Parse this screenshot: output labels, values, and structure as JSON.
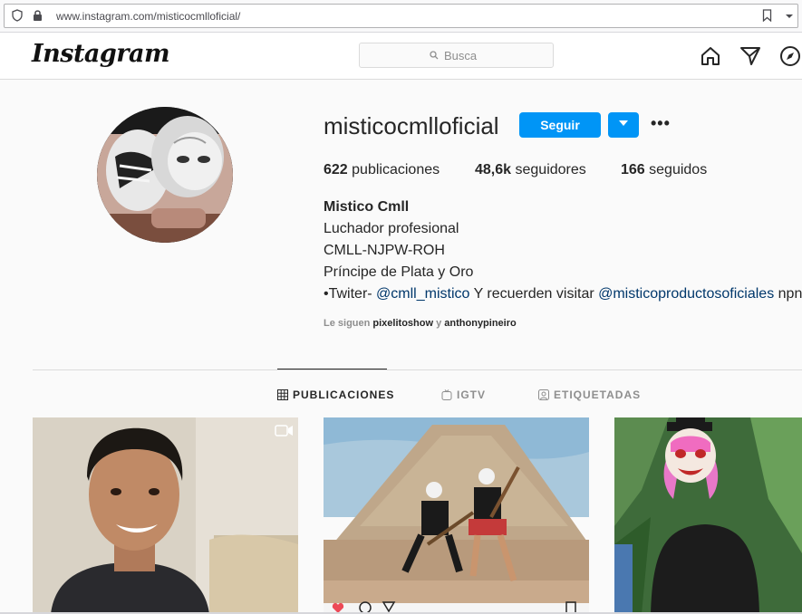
{
  "browser": {
    "url": "www.instagram.com/misticocmlloficial/",
    "icons": [
      "shield-icon",
      "lock-icon",
      "bookmark-icon",
      "chevron-down-icon"
    ]
  },
  "header": {
    "logo": "Instagram",
    "search_placeholder": "Busca",
    "nav_icons": [
      "home-icon",
      "direct-message-icon",
      "explore-icon"
    ]
  },
  "profile": {
    "username": "misticocmlloficial",
    "follow_label": "Seguir",
    "more_label": "•••",
    "stats": {
      "posts_count": "622",
      "posts_label": "publicaciones",
      "followers_count": "48,6k",
      "followers_label": "seguidores",
      "following_count": "166",
      "following_label": "seguidos"
    },
    "full_name": "Mistico Cmll",
    "bio_lines": [
      "Luchador profesional",
      "CMLL-NJPW-ROH",
      "Príncipe de Plata y Oro"
    ],
    "bio_twitter_prefix": "•Twiter- ",
    "bio_twitter_handle": "@cmll_mistico",
    "bio_mid": " Y recuerden visitar ",
    "bio_shop_handle": "@misticoproductosoficiales",
    "bio_tail": " npn",
    "followed_by_prefix": "Le siguen",
    "followed_by_user1": "pixelitoshow",
    "followed_by_and": "y",
    "followed_by_user2": "anthonypineiro"
  },
  "tabs": [
    {
      "label": "PUBLICACIONES",
      "icon": "grid-icon",
      "active": true
    },
    {
      "label": "IGTV",
      "icon": "igtv-icon",
      "active": false
    },
    {
      "label": "ETIQUETADAS",
      "icon": "tagged-icon",
      "active": false
    }
  ],
  "colors": {
    "accent": "#0095f6",
    "link": "#00376b",
    "background": "#fafafa"
  }
}
